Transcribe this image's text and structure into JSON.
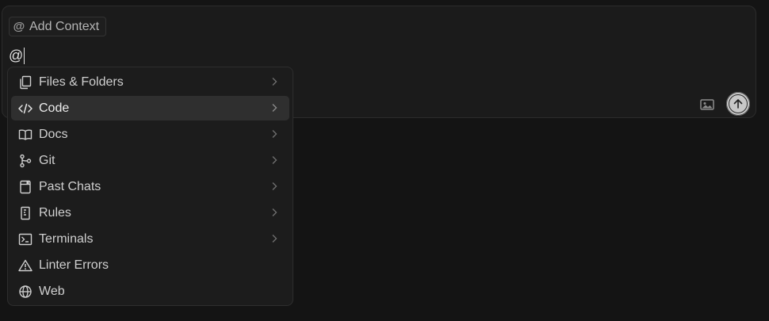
{
  "composer": {
    "add_context_label": "Add Context",
    "typed_text": "@"
  },
  "mention_menu": {
    "items": [
      {
        "label": "Files & Folders",
        "icon": "files-icon",
        "has_submenu": true,
        "active": false
      },
      {
        "label": "Code",
        "icon": "code-icon",
        "has_submenu": true,
        "active": true
      },
      {
        "label": "Docs",
        "icon": "book-icon",
        "has_submenu": true,
        "active": false
      },
      {
        "label": "Git",
        "icon": "git-branch-icon",
        "has_submenu": true,
        "active": false
      },
      {
        "label": "Past Chats",
        "icon": "chat-history-icon",
        "has_submenu": true,
        "active": false
      },
      {
        "label": "Rules",
        "icon": "rules-icon",
        "has_submenu": true,
        "active": false
      },
      {
        "label": "Terminals",
        "icon": "terminal-icon",
        "has_submenu": true,
        "active": false
      },
      {
        "label": "Linter Errors",
        "icon": "warning-icon",
        "has_submenu": false,
        "active": false
      },
      {
        "label": "Web",
        "icon": "globe-icon",
        "has_submenu": false,
        "active": false
      }
    ]
  },
  "colors": {
    "background": "#141414",
    "panel": "#1b1b1b",
    "menu_active": "#2f2f2f",
    "send_button": "#c8c8c8"
  }
}
